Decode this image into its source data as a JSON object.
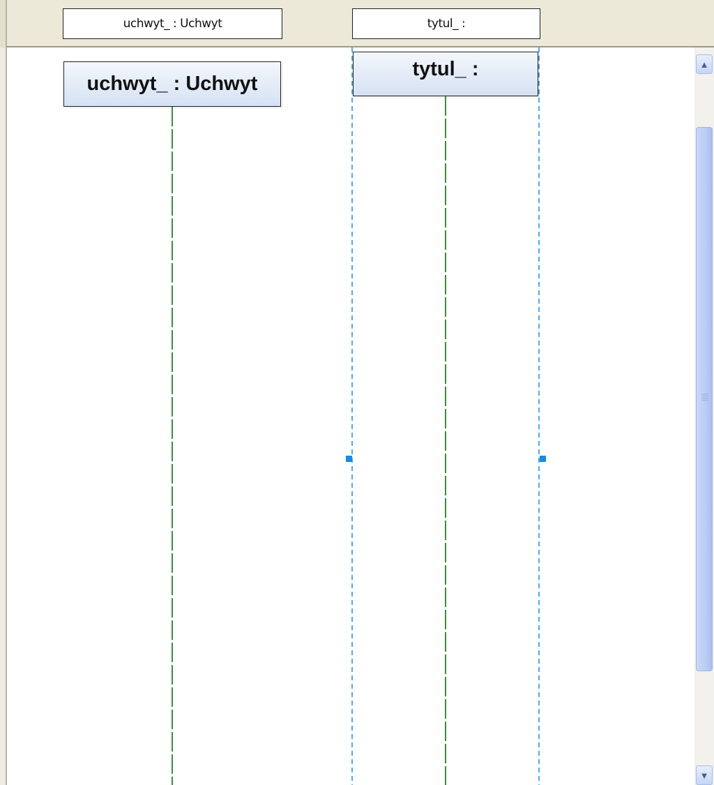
{
  "header": {
    "boxes": [
      {
        "label": "uchwyt_ : Uchwyt"
      },
      {
        "label": "tytul_ :"
      }
    ]
  },
  "diagram": {
    "lifelines": [
      {
        "name": "uchwyt_ : Uchwyt",
        "selected": false
      },
      {
        "name": "tytul_ :",
        "selected": true
      }
    ]
  },
  "scrollbar": {
    "up_icon": "chevron-up-icon",
    "down_icon": "chevron-down-icon",
    "thumb_grip_icon": "grip-icon"
  },
  "colors": {
    "lifeline": "#3c8c3c",
    "selection": "#1b8be0",
    "head_top": "#f4f7fc",
    "head_bottom": "#d5e1f3",
    "header_bg": "#ece9d8"
  }
}
